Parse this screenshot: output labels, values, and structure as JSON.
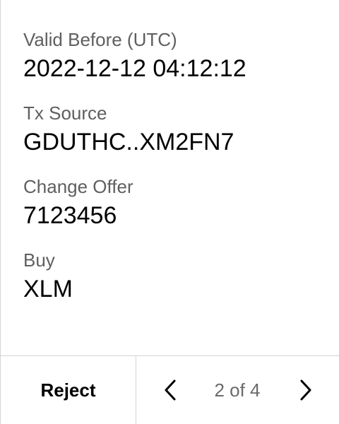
{
  "fields": [
    {
      "label": "Valid Before (UTC)",
      "value": "2022-12-12 04:12:12"
    },
    {
      "label": "Tx Source",
      "value": "GDUTHC..XM2FN7"
    },
    {
      "label": "Change Offer",
      "value": "7123456"
    },
    {
      "label": "Buy",
      "value": "XLM"
    }
  ],
  "footer": {
    "reject_label": "Reject",
    "prev_icon": "chevron-left-icon",
    "next_icon": "chevron-right-icon",
    "page_indicator": "2 of 4"
  },
  "colors": {
    "label": "#5f5f5f",
    "value": "#000000",
    "border": "#d4d4d4",
    "page_indicator": "#6a6a6a"
  }
}
